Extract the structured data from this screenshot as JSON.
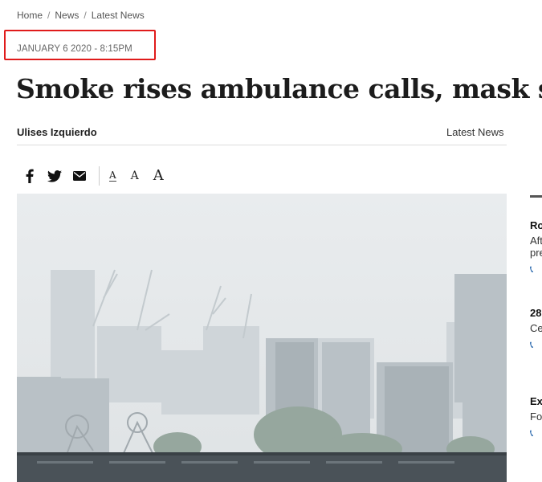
{
  "breadcrumb": {
    "home": "Home",
    "news": "News",
    "latest": "Latest News",
    "separator": "/"
  },
  "article": {
    "date": "JANUARY 6 2020 - 8:15PM",
    "headline": "Smoke rises ambulance calls, mask sales",
    "author": "Ulises Izquierdo",
    "section": "Latest News"
  },
  "share": {
    "icons": [
      "facebook-icon",
      "twitter-icon",
      "email-icon"
    ],
    "font_small": "A",
    "font_medium": "A",
    "font_large": "A"
  },
  "sidebar": {
    "items": [
      {
        "title": "Ro",
        "line1": "Aft",
        "line2": "pre"
      },
      {
        "title": "28",
        "line1": "Ce",
        "line2": ""
      },
      {
        "title": "Ex",
        "line1": "Fo",
        "line2": ""
      }
    ]
  },
  "colors": {
    "highlight": "#e01b1b",
    "phone": "#1b5ea8",
    "haze_sky": "#e9ecee"
  }
}
